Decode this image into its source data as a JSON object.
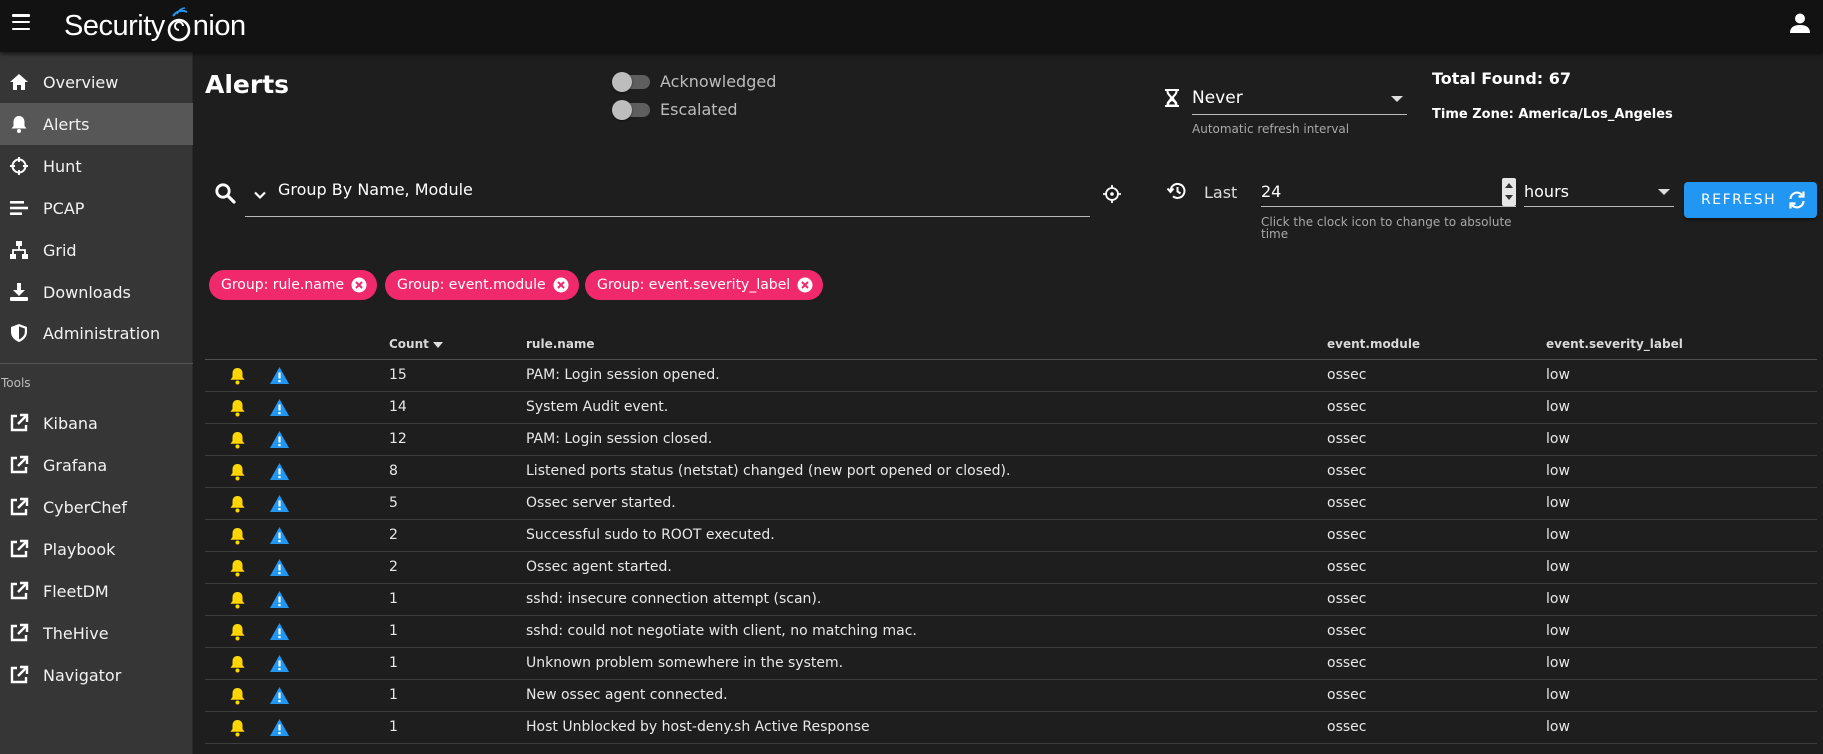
{
  "app": {
    "logo_left": "Security",
    "logo_right": "nion"
  },
  "sidebar": {
    "items": [
      {
        "label": "Overview",
        "icon": "home-icon"
      },
      {
        "label": "Alerts",
        "icon": "bell-icon",
        "active": true
      },
      {
        "label": "Hunt",
        "icon": "crosshairs-icon"
      },
      {
        "label": "PCAP",
        "icon": "list-lines-icon"
      },
      {
        "label": "Grid",
        "icon": "sitemap-icon"
      },
      {
        "label": "Downloads",
        "icon": "download-icon"
      },
      {
        "label": "Administration",
        "icon": "shield-icon"
      }
    ],
    "tools_label": "Tools",
    "tools": [
      {
        "label": "Kibana",
        "icon": "external-link-icon"
      },
      {
        "label": "Grafana",
        "icon": "external-link-icon"
      },
      {
        "label": "CyberChef",
        "icon": "external-link-icon"
      },
      {
        "label": "Playbook",
        "icon": "external-link-icon"
      },
      {
        "label": "FleetDM",
        "icon": "external-link-icon"
      },
      {
        "label": "TheHive",
        "icon": "external-link-icon"
      },
      {
        "label": "Navigator",
        "icon": "external-link-icon"
      }
    ]
  },
  "header": {
    "title": "Alerts",
    "acknowledged_label": "Acknowledged",
    "escalated_label": "Escalated",
    "refresh_interval_value": "Never",
    "refresh_interval_hint": "Automatic refresh interval",
    "total_found": "Total Found: 67",
    "time_zone": "Time Zone: America/Los_Angeles"
  },
  "query": {
    "text": "Group By Name, Module",
    "last_label": "Last",
    "last_value": "24",
    "last_hint": "Click the clock icon to change to absolute time",
    "units": "hours",
    "refresh_label": "REFRESH"
  },
  "chips": [
    {
      "label": "Group: rule.name"
    },
    {
      "label": "Group: event.module"
    },
    {
      "label": "Group: event.severity_label"
    }
  ],
  "table": {
    "columns": [
      "Count",
      "rule.name",
      "event.module",
      "event.severity_label"
    ],
    "rows": [
      {
        "count": "15",
        "name": "PAM: Login session opened.",
        "module": "ossec",
        "severity": "low"
      },
      {
        "count": "14",
        "name": "System Audit event.",
        "module": "ossec",
        "severity": "low"
      },
      {
        "count": "12",
        "name": "PAM: Login session closed.",
        "module": "ossec",
        "severity": "low"
      },
      {
        "count": "8",
        "name": "Listened ports status (netstat) changed (new port opened or closed).",
        "module": "ossec",
        "severity": "low"
      },
      {
        "count": "5",
        "name": "Ossec server started.",
        "module": "ossec",
        "severity": "low"
      },
      {
        "count": "2",
        "name": "Successful sudo to ROOT executed.",
        "module": "ossec",
        "severity": "low"
      },
      {
        "count": "2",
        "name": "Ossec agent started.",
        "module": "ossec",
        "severity": "low"
      },
      {
        "count": "1",
        "name": "sshd: insecure connection attempt (scan).",
        "module": "ossec",
        "severity": "low"
      },
      {
        "count": "1",
        "name": "sshd: could not negotiate with client, no matching mac.",
        "module": "ossec",
        "severity": "low"
      },
      {
        "count": "1",
        "name": "Unknown problem somewhere in the system.",
        "module": "ossec",
        "severity": "low"
      },
      {
        "count": "1",
        "name": "New ossec agent connected.",
        "module": "ossec",
        "severity": "low"
      },
      {
        "count": "1",
        "name": "Host Unblocked by host-deny.sh Active Response",
        "module": "ossec",
        "severity": "low"
      }
    ]
  },
  "colors": {
    "accent": "#2196f3",
    "chip": "#f0286c",
    "bell": "#ffd600",
    "warn": "#2196f3",
    "sidebar_bg": "#363636",
    "topbar_bg": "#121212"
  }
}
